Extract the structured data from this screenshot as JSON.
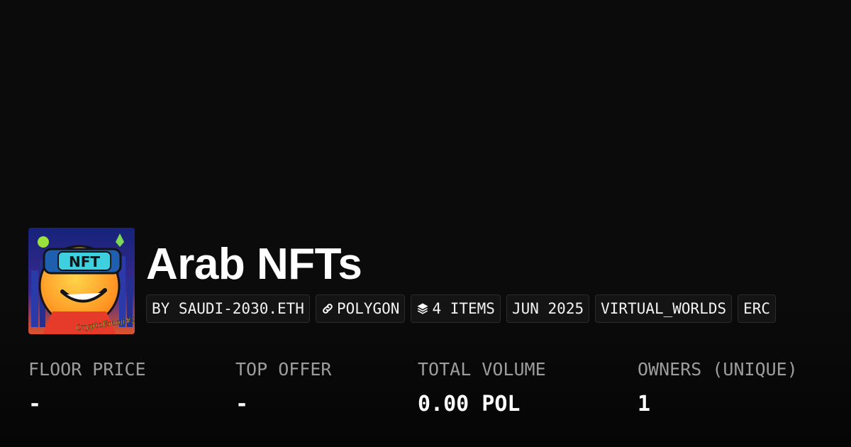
{
  "collection": {
    "title": "Arab NFTs",
    "avatar_alt": "CryptoEmoji #2",
    "avatar_text": "NFT",
    "avatar_caption": "CryptoEmoji#2"
  },
  "tags": {
    "creator": "BY SAUDI-2030.ETH",
    "chain": "POLYGON",
    "items": "4 ITEMS",
    "date": "JUN 2025",
    "category": "VIRTUAL_WORLDS",
    "standard": "ERC"
  },
  "stats": {
    "floor_price": {
      "label": "FLOOR PRICE",
      "value": "-"
    },
    "top_offer": {
      "label": "TOP OFFER",
      "value": "-"
    },
    "total_volume": {
      "label": "TOTAL VOLUME",
      "value": "0.00 POL"
    },
    "owners": {
      "label": "OWNERS (UNIQUE)",
      "value": "1"
    }
  },
  "icons": {
    "chain_icon": "link-icon",
    "items_icon": "layers-icon"
  },
  "colors": {
    "background": "#0b0b0b",
    "tag_background": "#141414",
    "label_gray": "#9c9c9c"
  }
}
